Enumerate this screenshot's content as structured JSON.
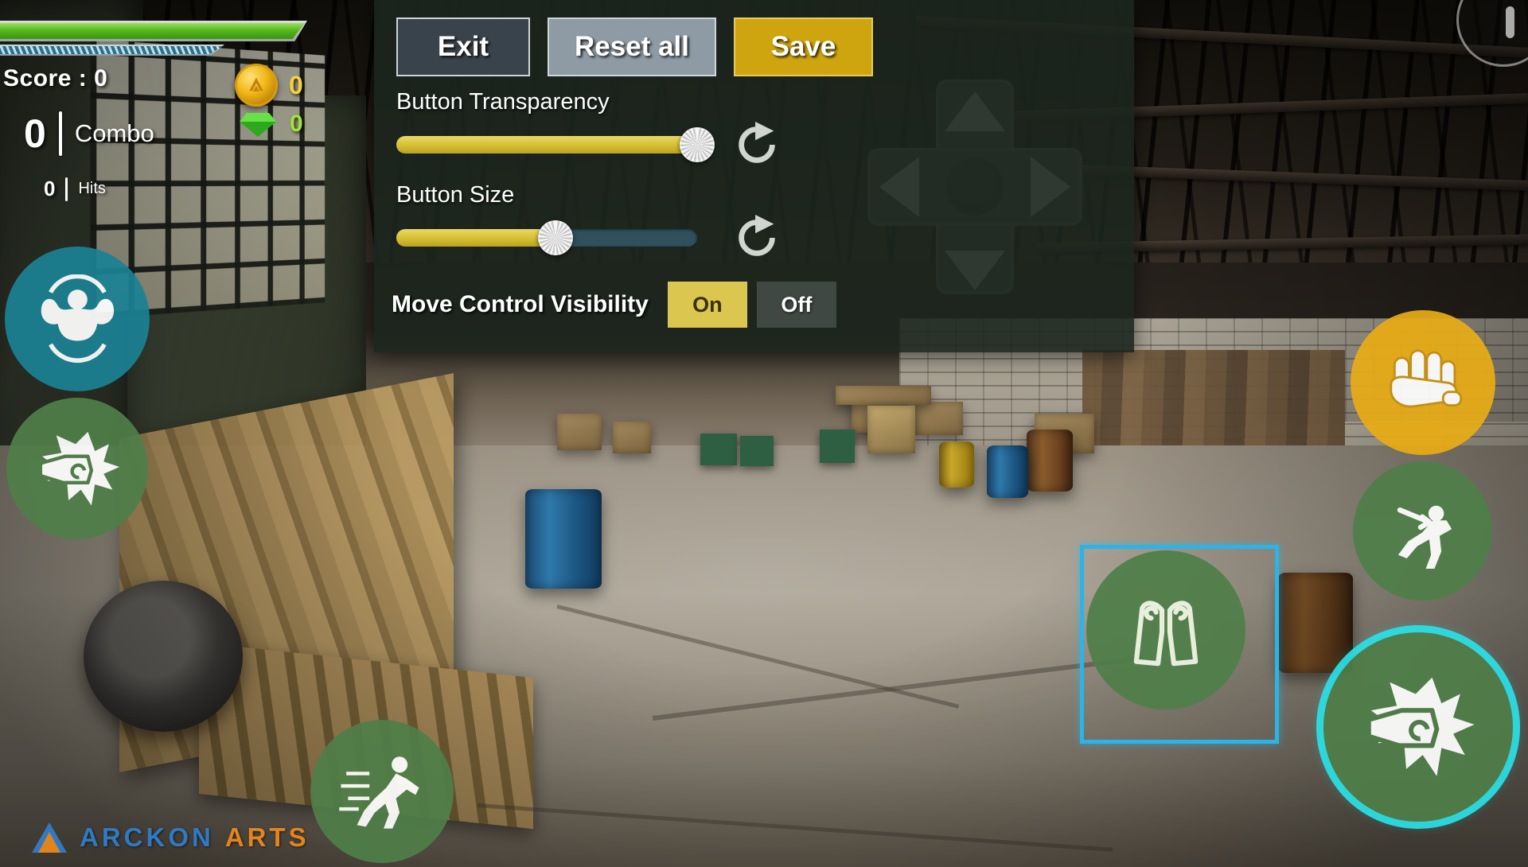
{
  "hud": {
    "score_label": "Score :",
    "score_value": "0",
    "combo_value": "0",
    "combo_label": "Combo",
    "hits_value": "0",
    "hits_label": "Hits",
    "coin_value": "0",
    "gem_value": "0",
    "health_percent": 100,
    "stamina_percent": 100,
    "health_color": "#56b81e",
    "stamina_color": "#2d6f88"
  },
  "pause_button": {
    "name": "pause"
  },
  "panel": {
    "buttons": [
      {
        "id": "exit",
        "label": "Exit"
      },
      {
        "id": "reset_all",
        "label": "Reset all"
      },
      {
        "id": "save",
        "label": "Save"
      }
    ],
    "settings": [
      {
        "id": "button_transparency",
        "label": "Button Transparency",
        "value_percent": 100,
        "reset_icon": "reset-refresh-icon"
      },
      {
        "id": "button_size",
        "label": "Button Size",
        "value_percent": 53,
        "reset_icon": "reset-refresh-icon"
      }
    ],
    "visibility": {
      "label": "Move Control Visibility",
      "options": [
        {
          "id": "on",
          "label": "On",
          "selected": true
        },
        {
          "id": "off",
          "label": "Off",
          "selected": false
        }
      ]
    },
    "colors": {
      "panel_bg": "#1c261e",
      "save_bg": "#cfa50f",
      "reset_bg": "#8e9ba5",
      "exit_bg": "#39434b",
      "slider_fill": "#d6bf32",
      "slider_track": "#30505e",
      "toggle_active": "#dbc64f"
    }
  },
  "dpad": {
    "name": "move-control-dpad",
    "directions": [
      "up",
      "right",
      "down",
      "left"
    ]
  },
  "action_buttons": [
    {
      "id": "flex",
      "icon": "flex-muscle-icon",
      "color": "#1b8294",
      "selected": false,
      "highlight": "none"
    },
    {
      "id": "punch_left",
      "icon": "punch-fist-icon",
      "color": "#4f7e49",
      "selected": false,
      "highlight": "none"
    },
    {
      "id": "run",
      "icon": "running-man-icon",
      "color": "#4f7e49",
      "selected": false,
      "highlight": "none"
    },
    {
      "id": "grab",
      "icon": "grab-hand-icon",
      "color": "#e8ac16",
      "selected": false,
      "highlight": "none"
    },
    {
      "id": "dive",
      "icon": "dive-dodge-icon",
      "color": "#4f7e49",
      "selected": false,
      "highlight": "none"
    },
    {
      "id": "block",
      "icon": "block-guard-icon",
      "color": "#4f7e49",
      "selected": true,
      "highlight": "square"
    },
    {
      "id": "punch_right",
      "icon": "punch-fist-icon",
      "color": "#4f7e49",
      "selected": true,
      "highlight": "ring"
    }
  ],
  "selection": {
    "box_color": "#2ab4e8",
    "ring_color": "#2ae0e6"
  },
  "logo": {
    "primary": "ARCKON",
    "secondary": "ARTS",
    "primary_color": "#2f7fcf",
    "secondary_color": "#ef8a1d"
  }
}
